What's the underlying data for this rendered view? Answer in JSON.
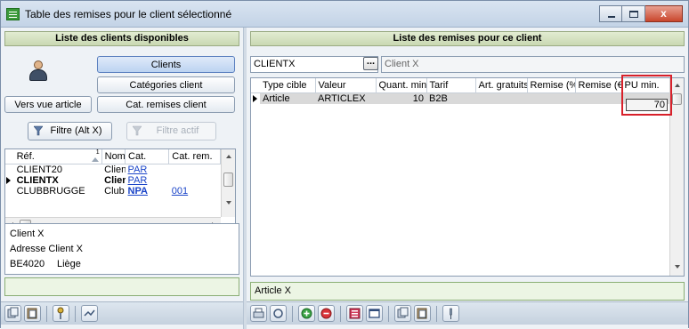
{
  "window": {
    "title": "Table des remises pour le client sélectionné",
    "close_glyph": "x"
  },
  "left": {
    "header": "Liste des clients disponibles",
    "buttons": {
      "clients": "Clients",
      "categories_client": "Catégories client",
      "vers_vue_article": "Vers vue article",
      "cat_remises_client": "Cat. remises client",
      "filtre": "Filtre (Alt X)",
      "filtre_actif": "Filtre actif"
    },
    "table": {
      "columns": [
        "Réf.",
        "1",
        "Nom",
        "Cat.",
        "Cat. rem."
      ],
      "rows": [
        {
          "ref": "CLIENT20",
          "nom": "Client",
          "cat": "PAR",
          "catrem": ""
        },
        {
          "ref": "CLIENTX",
          "nom": "Clier",
          "cat": "PAR",
          "catrem": ""
        },
        {
          "ref": "CLUBBRUGGE",
          "nom": "Club",
          "cat": "NPA",
          "catrem": "001"
        }
      ]
    },
    "address": {
      "name": "Client X",
      "line": "Adresse Client X",
      "zip": "BE4020",
      "city": "Liège"
    }
  },
  "right": {
    "header": "Liste des remises pour ce client",
    "client_code": "CLIENTX",
    "ellipsis": "...",
    "client_name": "Client X",
    "table": {
      "columns": [
        "Type cible",
        "Valeur",
        "Quant. min.",
        "Tarif",
        "Art. gratuits",
        "Remise (%)",
        "Remise (€)",
        "PU min."
      ],
      "rows": [
        {
          "type": "Article",
          "valeur": "ARTICLEX",
          "quant": "10",
          "tarif": "B2B",
          "art": "",
          "rem_pct": "",
          "rem_eur": "",
          "pu": "70"
        }
      ]
    },
    "footer_text": "Article X"
  },
  "icons": {
    "toolbar_left": [
      "copy-icon",
      "paste-icon",
      "key-icon",
      "pen-icon"
    ],
    "toolbar_right": [
      "print-icon",
      "refresh-icon",
      "add-icon",
      "delete-icon",
      "list-icon",
      "window-icon",
      "copy-icon",
      "paste-icon",
      "pin-icon"
    ]
  }
}
